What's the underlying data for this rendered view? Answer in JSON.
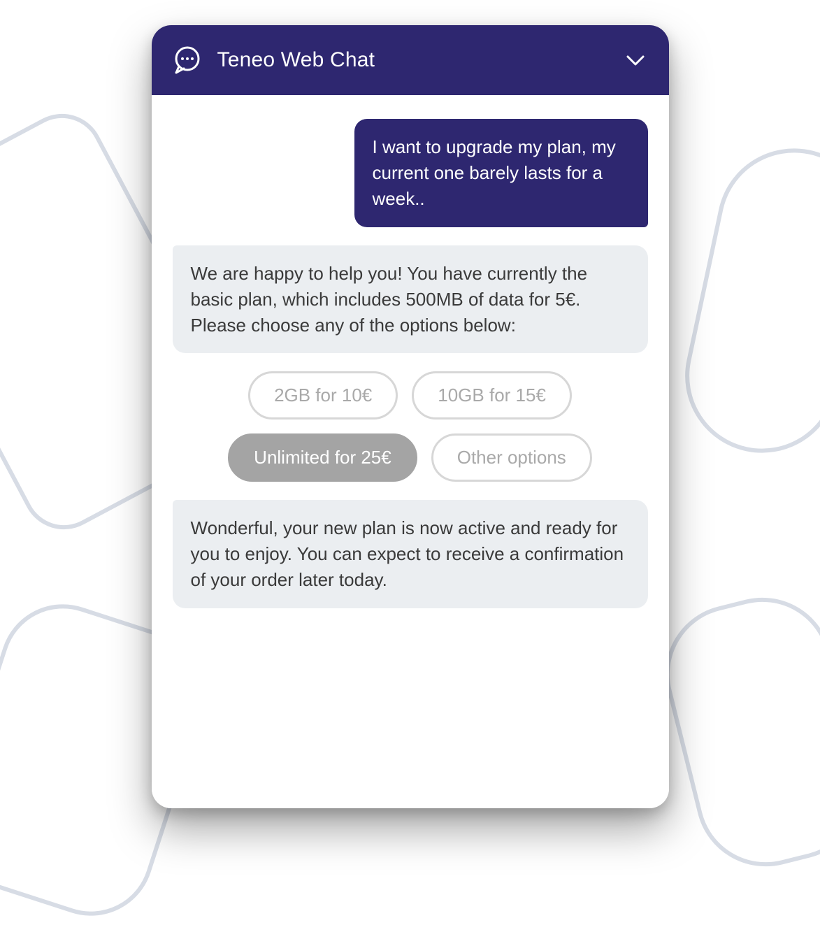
{
  "colors": {
    "primary": "#2e2770",
    "bot_bubble": "#ebeef1",
    "chip_selected": "#a4a4a4"
  },
  "header": {
    "title": "Teneo Web Chat",
    "icon": "chat-bubble-icon",
    "minimize_icon": "chevron-down-icon"
  },
  "messages": {
    "user_1": "I want to upgrade my plan, my current one barely lasts for a week..",
    "bot_1": "We are happy to help you! You have currently the basic plan, which includes 500MB of data for 5€. Please choose any of the options below:",
    "bot_2": "Wonderful, your new plan is now active and ready for you to enjoy. You can expect to receive a confirmation of your order later today."
  },
  "options": [
    {
      "label": "2GB for 10€",
      "selected": false
    },
    {
      "label": "10GB for 15€",
      "selected": false
    },
    {
      "label": "Unlimited for 25€",
      "selected": true
    },
    {
      "label": "Other options",
      "selected": false
    }
  ]
}
